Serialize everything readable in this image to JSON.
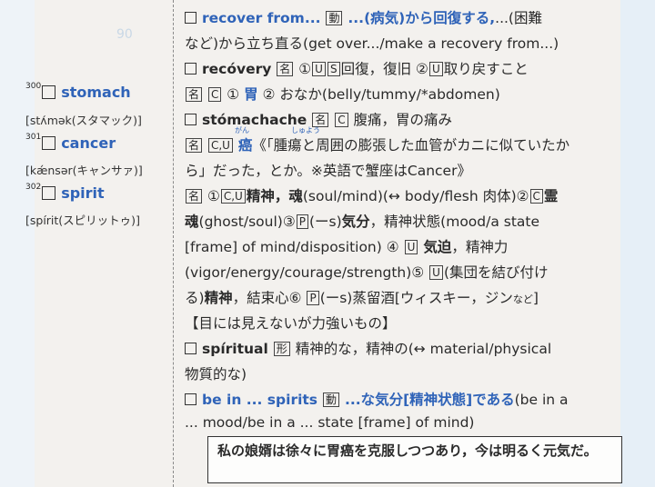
{
  "headwords": [
    {
      "num": "300",
      "word": "stomach",
      "pron": "[stʌ́mək(スタマック)]"
    },
    {
      "num": "301",
      "word": "cancer",
      "pron": "[kǽnsər(キャンサァ)]"
    },
    {
      "num": "302",
      "word": "spirit",
      "pron": "[spírit(スピリットゥ)]"
    }
  ],
  "lines": {
    "l1": {
      "phrase": "recover from...",
      "pos": "動",
      "meaning": "...(病気)から回復する,",
      "tail": "...(困難"
    },
    "l2": {
      "text": "など)から立ち直る(get over.../make a recovery from...)"
    },
    "l3": {
      "word": "recóvery",
      "pos": "名",
      "rest1": "①",
      "u1": "U",
      "s1": "S",
      "rest2": "回復，復旧",
      "n2": "②",
      "u2": "U",
      "rest3": "取り戻すこと"
    },
    "l4": {
      "pos": "名",
      "c": "C",
      "n1": "①",
      "main": "胃",
      "n2": "②",
      "rest": "おなか(belly/tummy/*abdomen)"
    },
    "l5": {
      "word": "stómachache",
      "pos": "名",
      "c": "C",
      "rest": "腹痛，胃の痛み"
    },
    "l6": {
      "pos": "名",
      "cu": "C,U",
      "main": "癌",
      "ruby1": "がん",
      "ruby2": "しゅよう",
      "rest": "《「腫瘍と周囲の膨張した血管がカニに似ていたか"
    },
    "l7": {
      "text": "ら」だった，とか。※英語で蟹座はCancer》"
    },
    "l8": {
      "pos": "名",
      "n1": "①",
      "cu": "C,U",
      "b1": "精神，魂",
      "rest1": "(soul/mind)(↔ body/flesh 肉体)",
      "n2": "②",
      "c": "C",
      "b2": "霊"
    },
    "l9": {
      "b1": "魂",
      "rest1": "(ghost/soul)",
      "n3": "③",
      "p": "P",
      "rest2": "(ーs)",
      "b2": "気分",
      "rest3": "，精神状態(mood/a state"
    },
    "l10": {
      "text": "[frame] of mind/disposition)",
      "n4": "④",
      "u": "U",
      "b": "気迫",
      "rest": "，精神力"
    },
    "l11": {
      "text": "(vigor/energy/courage/strength)",
      "n5": "⑤",
      "u": "U",
      "rest": "(集団を結び付け"
    },
    "l12": {
      "pre": "る)",
      "b": "精神",
      "rest1": "，結束心",
      "n6": "⑥",
      "p": "P",
      "rest2": "(ーs)蒸留酒[ウィスキー，ジン",
      "small": "など",
      "end": "]"
    },
    "l13": {
      "text": "【目には見えないが力強いもの】"
    },
    "l14": {
      "word": "spíritual",
      "pos": "形",
      "rest": "精神的な，精神の(↔ material/physical"
    },
    "l15": {
      "text": "物質的な)"
    },
    "l16": {
      "phrase": "be in ... spirits",
      "pos": "動",
      "meaning": "...な気分[精神状態]である",
      "tail": "(be in a"
    },
    "l17": {
      "text": "... mood/be in a ... state [frame] of mind)"
    }
  },
  "example": "私の娘婿は徐々に胃癌を克服しつつあり，今は明るく元気だ。"
}
